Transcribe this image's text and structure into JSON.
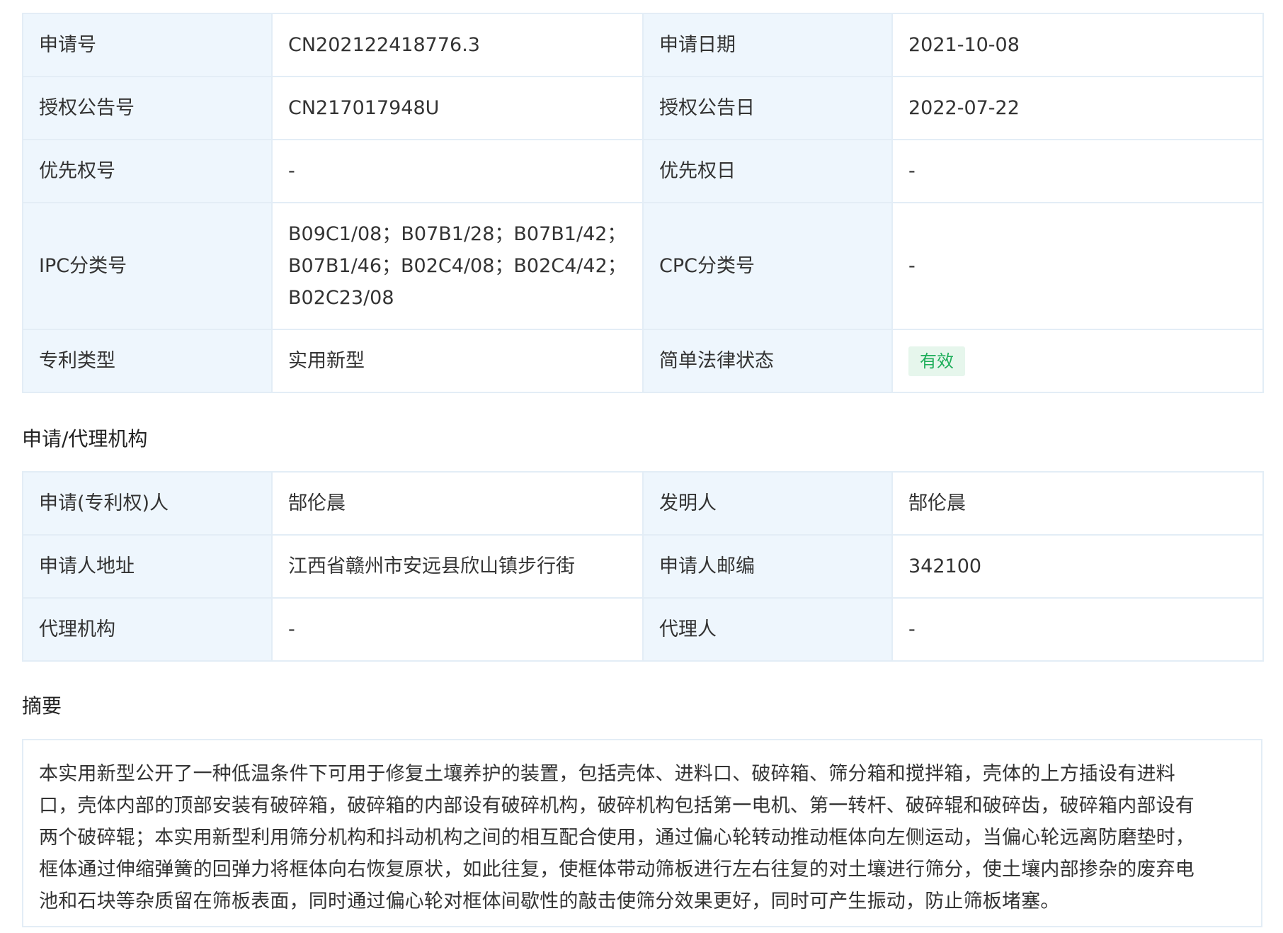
{
  "basic": {
    "rows": [
      {
        "l1": "申请号",
        "v1": "CN202122418776.3",
        "l2": "申请日期",
        "v2": "2021-10-08"
      },
      {
        "l1": "授权公告号",
        "v1": "CN217017948U",
        "l2": "授权公告日",
        "v2": "2022-07-22"
      },
      {
        "l1": "优先权号",
        "v1": "-",
        "l2": "优先权日",
        "v2": "-"
      },
      {
        "l1": "IPC分类号",
        "v1_lines": [
          "B09C1/08；B07B1/28；B07B1/42；",
          "B07B1/46；B02C4/08；B02C4/42；",
          "B02C23/08"
        ],
        "l2": "CPC分类号",
        "v2": "-"
      },
      {
        "l1": "专利类型",
        "v1": "实用新型",
        "l2": "简单法律状态",
        "v2_badge": "有效"
      }
    ]
  },
  "agency": {
    "title": "申请/代理机构",
    "rows": [
      {
        "l1": "申请(专利权)人",
        "v1": "郜伦晨",
        "l2": "发明人",
        "v2": "郜伦晨"
      },
      {
        "l1": "申请人地址",
        "v1": "江西省赣州市安远县欣山镇步行街",
        "l2": "申请人邮编",
        "v2": "342100"
      },
      {
        "l1": "代理机构",
        "v1": "-",
        "l2": "代理人",
        "v2": "-"
      }
    ]
  },
  "abstract": {
    "title": "摘要",
    "lines": [
      "本实用新型公开了一种低温条件下可用于修复土壤养护的装置，包括壳体、进料口、破碎箱、筛分箱和搅拌箱，壳体的上方插设有进料",
      "口，壳体内部的顶部安装有破碎箱，破碎箱的内部设有破碎机构，破碎机构包括第一电机、第一转杆、破碎辊和破碎齿，破碎箱内部设有",
      "两个破碎辊；本实用新型利用筛分机构和抖动机构之间的相互配合使用，通过偏心轮转动推动框体向左侧运动，当偏心轮远离防磨垫时，",
      "框体通过伸缩弹簧的回弹力将框体向右恢复原状，如此往复，使框体带动筛板进行左右往复的对土壤进行筛分，使土壤内部掺杂的废弃电",
      "池和石块等杂质留在筛板表面，同时通过偏心轮对框体间歇性的敲击使筛分效果更好，同时可产生振动，防止筛板堵塞。"
    ]
  },
  "colors": {
    "label_bg": "#eef6fd",
    "border": "#e3edf6",
    "badge_bg": "#e6f6ec",
    "badge_text": "#1eae5a"
  }
}
